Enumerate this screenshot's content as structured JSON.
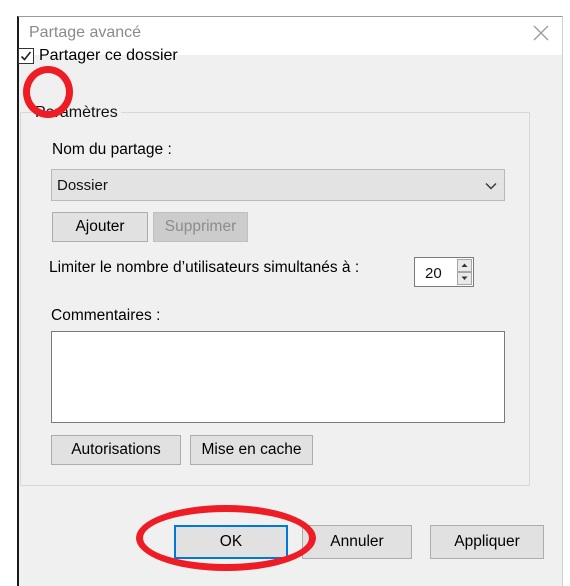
{
  "dialog": {
    "title": "Partage avancé",
    "close_icon": "close-icon"
  },
  "share": {
    "checkbox_checked": true,
    "label": "Partager ce dossier"
  },
  "group": {
    "legend": "Paramètres",
    "share_name_label": "Nom du partage :",
    "share_name_value": "Dossier",
    "add_button": "Ajouter",
    "remove_button": "Supprimer",
    "limit_label": "Limiter le nombre d’utilisateurs simultanés à :",
    "limit_value": "20",
    "comments_label": "Commentaires :",
    "comments_value": "",
    "permissions_button": "Autorisations",
    "caching_button": "Mise en cache"
  },
  "footer": {
    "ok_button": "OK",
    "cancel_button": "Annuler",
    "apply_button": "Appliquer"
  },
  "annotations": {
    "color": "#ee1c25"
  }
}
